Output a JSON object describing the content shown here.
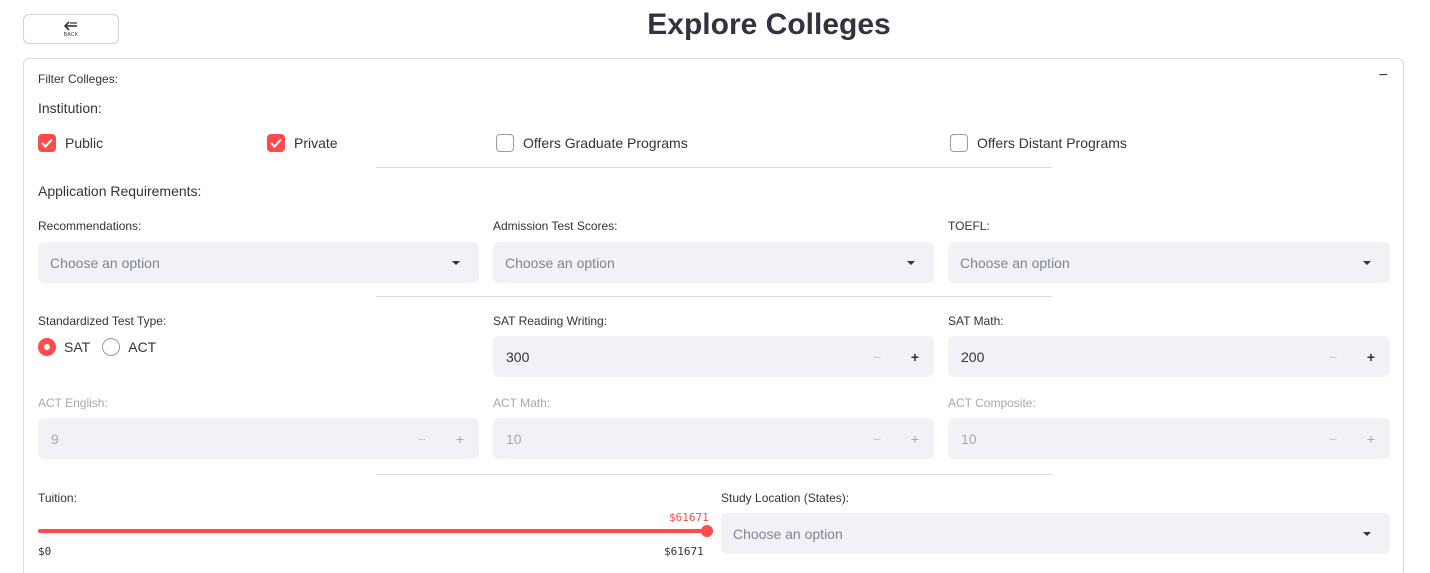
{
  "back_button": {
    "label": "BACK",
    "icon": "arrow-left-icon"
  },
  "page_title": "Explore Colleges",
  "filter": {
    "header": "Filter Colleges:",
    "collapse_symbol": "−",
    "institution": {
      "label": "Institution:",
      "options": [
        {
          "label": "Public",
          "checked": true
        },
        {
          "label": "Private",
          "checked": true
        },
        {
          "label": "Offers Graduate Programs",
          "checked": false
        },
        {
          "label": "Offers Distant Programs",
          "checked": false
        }
      ]
    },
    "application_requirements": {
      "label": "Application Requirements:",
      "recommendations": {
        "label": "Recommendations:",
        "placeholder": "Choose an option"
      },
      "admission_test_scores": {
        "label": "Admission Test Scores:",
        "placeholder": "Choose an option"
      },
      "toefl": {
        "label": "TOEFL:",
        "placeholder": "Choose an option"
      }
    },
    "test_type": {
      "label": "Standardized Test Type:",
      "options": [
        "SAT",
        "ACT"
      ],
      "selected": "SAT"
    },
    "sat_reading_writing": {
      "label": "SAT Reading Writing:",
      "value": "300"
    },
    "sat_math": {
      "label": "SAT Math:",
      "value": "200"
    },
    "act_english": {
      "label": "ACT English:",
      "value": "9",
      "disabled": true
    },
    "act_math": {
      "label": "ACT Math:",
      "value": "10",
      "disabled": true
    },
    "act_composite": {
      "label": "ACT Composite:",
      "value": "10",
      "disabled": true
    },
    "stepper": {
      "minus": "−",
      "plus": "+"
    },
    "tuition": {
      "label": "Tuition:",
      "min_label": "$0",
      "max_label": "$61671",
      "current_label": "$61671",
      "min": 0,
      "max": 61671,
      "value": 61671
    },
    "study_location": {
      "label": "Study Location (States):",
      "placeholder": "Choose an option"
    }
  },
  "colors": {
    "accent": "#ff4b4b",
    "input_bg": "#f0f2f6",
    "text": "#31333f",
    "disabled_text": "#a3a8b4"
  }
}
